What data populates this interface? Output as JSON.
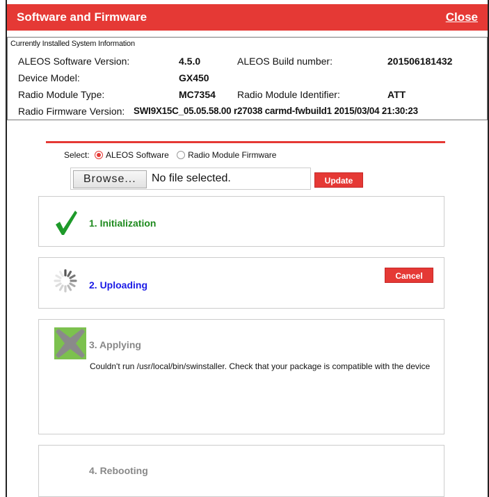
{
  "dialog": {
    "title": "Software and Firmware",
    "close_label": "Close"
  },
  "sysinfo": {
    "heading": "Currently Installed System Information",
    "software_version_label": "ALEOS Software Version:",
    "software_version": "4.5.0",
    "build_number_label": "ALEOS Build number:",
    "build_number": "201506181432",
    "device_model_label": "Device Model:",
    "device_model": "GX450",
    "radio_type_label": "Radio Module Type:",
    "radio_type": "MC7354",
    "radio_id_label": "Radio Module Identifier:",
    "radio_id": "ATT",
    "radio_fw_label": "Radio Firmware Version:",
    "radio_fw": "SWI9X15C_05.05.58.00 r27038 carmd-fwbuild1 2015/03/04 21:30:23"
  },
  "upload": {
    "select_label": "Select:",
    "option_software": "ALEOS Software",
    "option_firmware": "Radio Module Firmware",
    "selected": "ALEOS Software",
    "browse_label": "Browse...",
    "file_status": "No file selected.",
    "update_label": "Update"
  },
  "steps": {
    "initialization": {
      "title": "1. Initialization",
      "icon": "checkmark-icon",
      "color": "#1e8a1e"
    },
    "uploading": {
      "title": "2. Uploading",
      "icon": "spinner-icon",
      "color": "#1a1ae6",
      "cancel_label": "Cancel"
    },
    "applying": {
      "title": "3. Applying",
      "icon": "error-x-icon",
      "color": "#888888",
      "message": "Couldn't run /usr/local/bin/swinstaller. Check that your package is compatible with the device"
    },
    "rebooting": {
      "title": "4. Rebooting",
      "color": "#888888"
    }
  },
  "colors": {
    "accent": "#e53935",
    "success": "#1e8a1e",
    "active": "#1a1ae6",
    "error_icon": "#7cc14e"
  }
}
